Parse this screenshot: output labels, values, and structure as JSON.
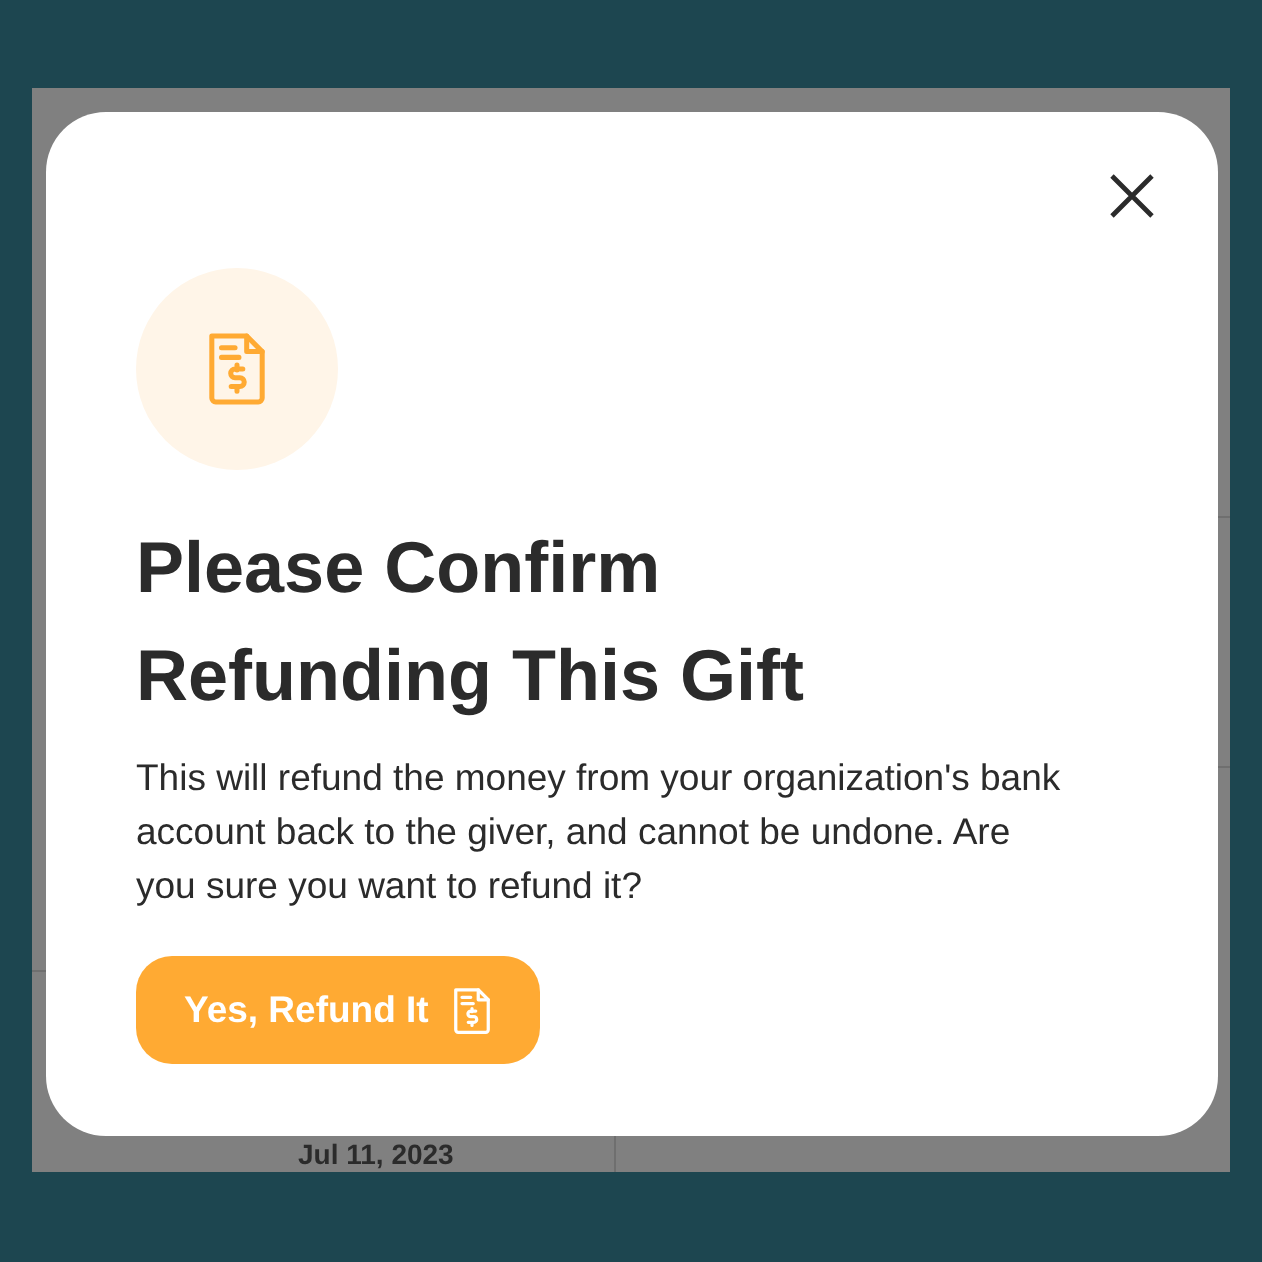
{
  "background": {
    "date": "Jul 11, 2023"
  },
  "dialog": {
    "title": "Please Confirm Refunding This Gift",
    "message": "This will refund the money from your organization's bank account back to the giver, and cannot be undone. Are you sure you want to refund it?",
    "confirm_button": "Yes, Refund It"
  }
}
